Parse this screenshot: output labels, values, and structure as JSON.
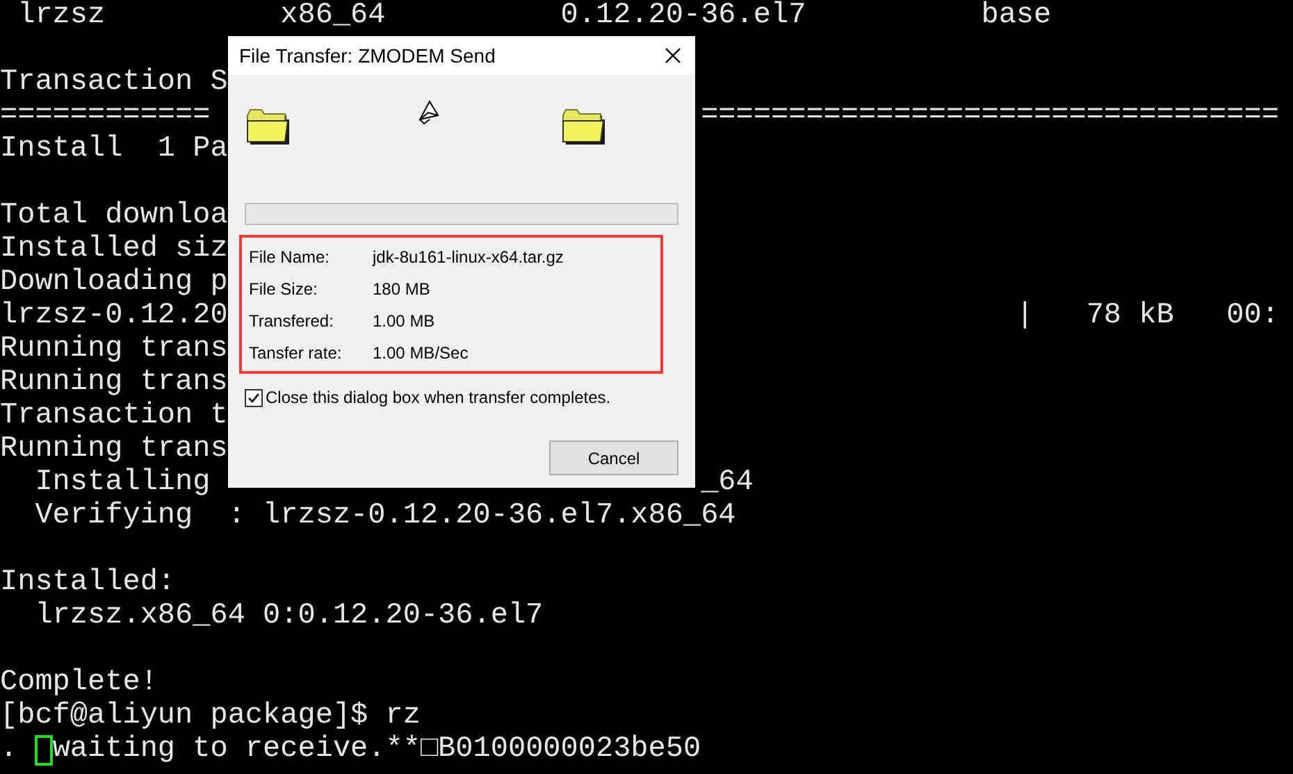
{
  "terminal": {
    "blocks": [
      [
        {
          "text": " lrzsz          x86_64          0.12.20-36.el7          base"
        }
      ],
      [
        {
          "text": "Transaction S"
        },
        {
          "text": "============",
          "right": "================================="
        },
        {
          "text": "Install  1 Pa"
        }
      ],
      [
        {
          "text": "Total downloa"
        },
        {
          "text": "Installed siz"
        },
        {
          "text": "Downloading p"
        },
        {
          "text": "lrzsz-0.12.20",
          "right": "                  |   78 kB   00:"
        },
        {
          "text": "Running trans"
        },
        {
          "text": "Running trans"
        },
        {
          "text": "Transaction t"
        },
        {
          "text": "Running trans"
        },
        {
          "text": "  Installing",
          "right": "_64"
        },
        {
          "text": "  Verifying  : lrzsz-0.12.20-36.el7.x86_64"
        }
      ],
      [
        {
          "text": "Installed:"
        },
        {
          "text": "  lrzsz.x86_64 0:0.12.20-36.el7"
        }
      ],
      [
        {
          "text": "Complete!"
        },
        {
          "text": "[bcf@aliyun package]$ rz"
        },
        {
          "text": ". ",
          "cursor": true,
          "after": "waiting to receive.**□B0100000023be50"
        }
      ]
    ]
  },
  "dialog": {
    "title": "File Transfer: ZMODEM Send",
    "progress": {
      "level": 0
    },
    "info": [
      {
        "label": "File Name:",
        "value": "jdk-8u161-linux-x64.tar.gz"
      },
      {
        "label": "File Size:",
        "value": "180 MB"
      },
      {
        "label": "Transfered:",
        "value": "1.00 MB"
      },
      {
        "label": "Tansfer rate:",
        "value": "1.00 MB/Sec"
      }
    ],
    "close_option": {
      "label": "Close this dialog box when transfer completes.",
      "checked": true
    },
    "cancel_button": "Cancel"
  }
}
